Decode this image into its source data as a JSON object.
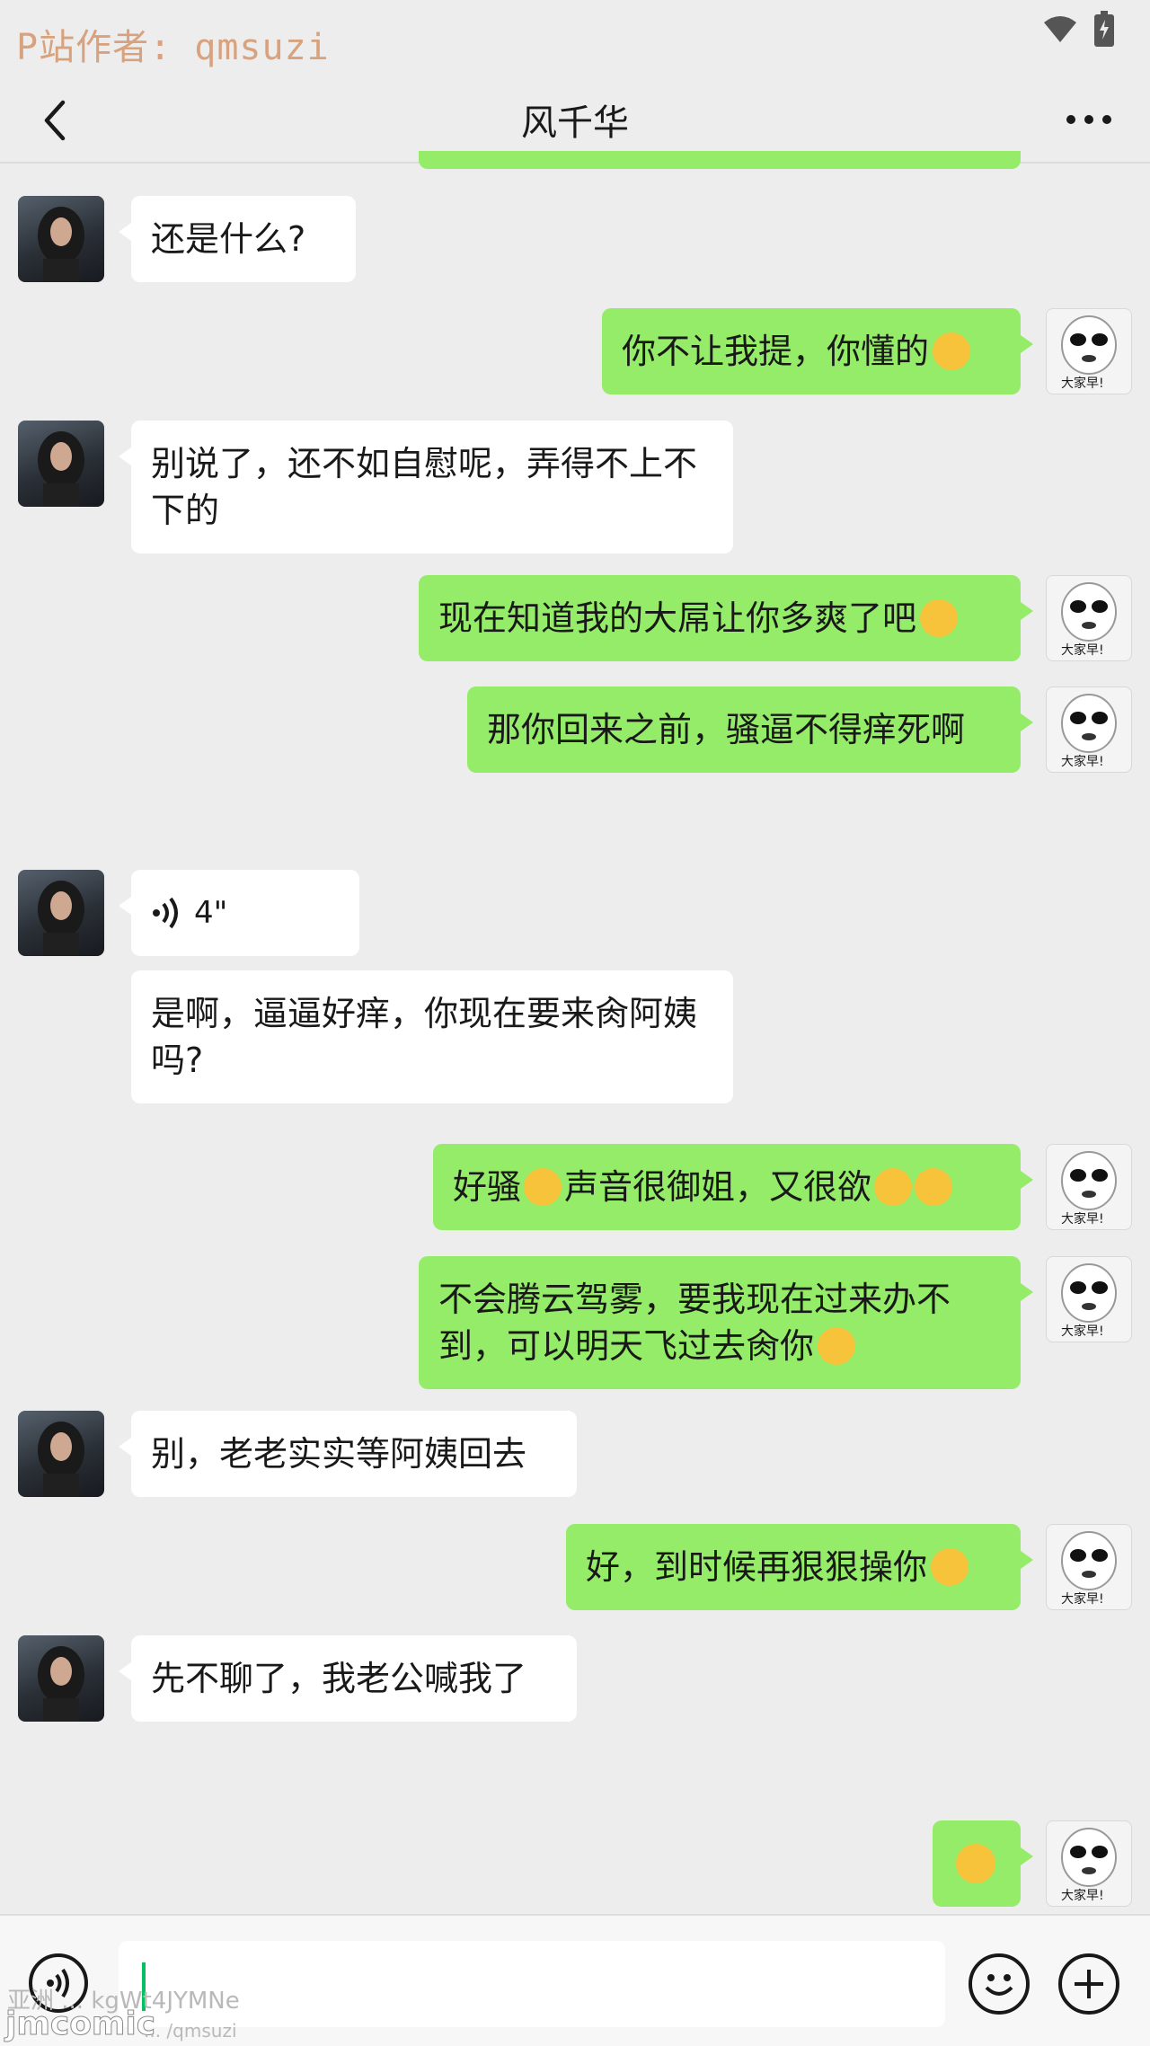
{
  "status_bar": {
    "watermark": "P站作者: qmsuzi",
    "icons": [
      "wifi-icon",
      "battery-icon"
    ]
  },
  "header": {
    "title": "风千华",
    "back_icon": "chevron-left-icon",
    "more_icon": "more-dots-icon"
  },
  "messages": [
    {
      "side": "left",
      "text": "还是什么?"
    },
    {
      "side": "right",
      "text": "你不让我提，你懂的",
      "emoji": "grimace-emoji"
    },
    {
      "side": "left",
      "text": "别说了，还不如自慰呢，弄得不上不下的"
    },
    {
      "side": "right",
      "text": "现在知道我的大屌让你多爽了吧",
      "emoji": "grin-emoji"
    },
    {
      "side": "right",
      "text": "那你回来之前，骚逼不得痒死啊"
    },
    {
      "side": "left",
      "type": "voice",
      "duration": "4\""
    },
    {
      "side": "left",
      "text": "是啊，逼逼好痒，你现在要来肏阿姨吗?"
    },
    {
      "side": "right",
      "text": "好骚",
      "text2": "声音很御姐，又很欲",
      "emoji": "heart-eyes-emoji"
    },
    {
      "side": "right",
      "text": "不会腾云驾雾，要我现在过来办不到，可以明天飞过去肏你",
      "emoji": "heart-eyes-emoji"
    },
    {
      "side": "left",
      "text": "别，老老实实等阿姨回去"
    },
    {
      "side": "right",
      "text": "好，到时候再狠狠操你",
      "emoji": "heart-eyes-emoji"
    },
    {
      "side": "left",
      "text": "先不聊了，我老公喊我了"
    },
    {
      "side": "right",
      "type": "emoji-only",
      "emoji": "sad-emoji"
    }
  ],
  "avatar_caption": "大家早!",
  "input_bar": {
    "voice_icon": "voice-icon",
    "emoji_icon": "emoji-icon",
    "plus_icon": "plus-icon",
    "placeholder": ""
  },
  "watermarks": {
    "line1": "亚洲 ... kgWt4JYMNe",
    "line2": "jmcomic",
    "line3": "... /qmsuzi"
  },
  "colors": {
    "background": "#ededed",
    "bubble_right": "#95ec69",
    "bubble_left": "#ffffff",
    "cursor": "#07c160"
  }
}
